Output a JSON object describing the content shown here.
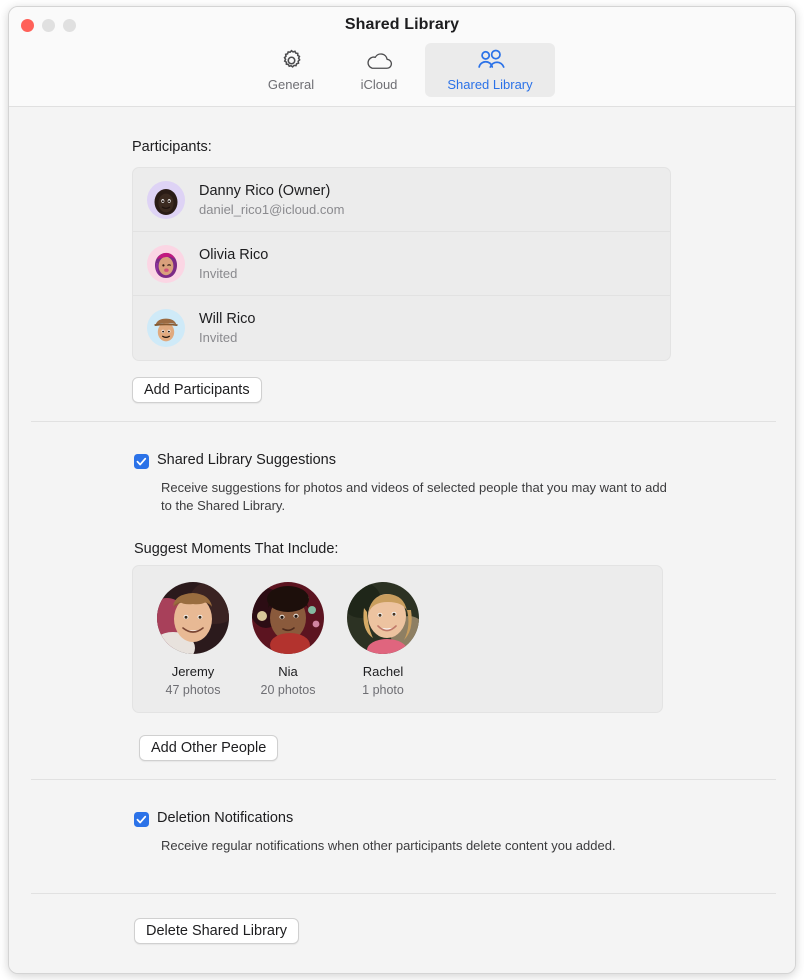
{
  "window": {
    "title": "Shared Library",
    "traffic_lights": [
      "close",
      "minimize",
      "maximize"
    ]
  },
  "toolbar": {
    "tabs": [
      {
        "label": "General",
        "icon": "gear-icon",
        "selected": false
      },
      {
        "label": "iCloud",
        "icon": "cloud-icon",
        "selected": false
      },
      {
        "label": "Shared Library",
        "icon": "people-icon",
        "selected": true
      }
    ]
  },
  "participants": {
    "heading": "Participants:",
    "rows": [
      {
        "name": "Danny Rico (Owner)",
        "detail": "daniel_rico1@icloud.com",
        "avatar": "memoji-danny"
      },
      {
        "name": "Olivia Rico",
        "detail": "Invited",
        "avatar": "memoji-olivia"
      },
      {
        "name": "Will Rico",
        "detail": "Invited",
        "avatar": "memoji-will"
      }
    ],
    "add_button": "Add Participants"
  },
  "suggestions": {
    "checkbox_label": "Shared Library Suggestions",
    "checkbox_checked": true,
    "description": "Receive suggestions for photos and videos of selected people that you may want to add to the Shared Library.",
    "moments_heading": "Suggest Moments That Include:",
    "people": [
      {
        "name": "Jeremy",
        "count": "47 photos"
      },
      {
        "name": "Nia",
        "count": "20 photos"
      },
      {
        "name": "Rachel",
        "count": "1 photo"
      }
    ],
    "add_people_button": "Add Other People"
  },
  "deletion": {
    "checkbox_label": "Deletion Notifications",
    "checkbox_checked": true,
    "description": "Receive regular notifications when other participants delete content you added."
  },
  "footer": {
    "delete_button": "Delete Shared Library"
  },
  "colors": {
    "accent": "#2b72e8",
    "close": "#ff6159",
    "window_bg": "#f4f4f4",
    "toolbar_bg": "#fafafa",
    "box_bg": "#ececec"
  }
}
